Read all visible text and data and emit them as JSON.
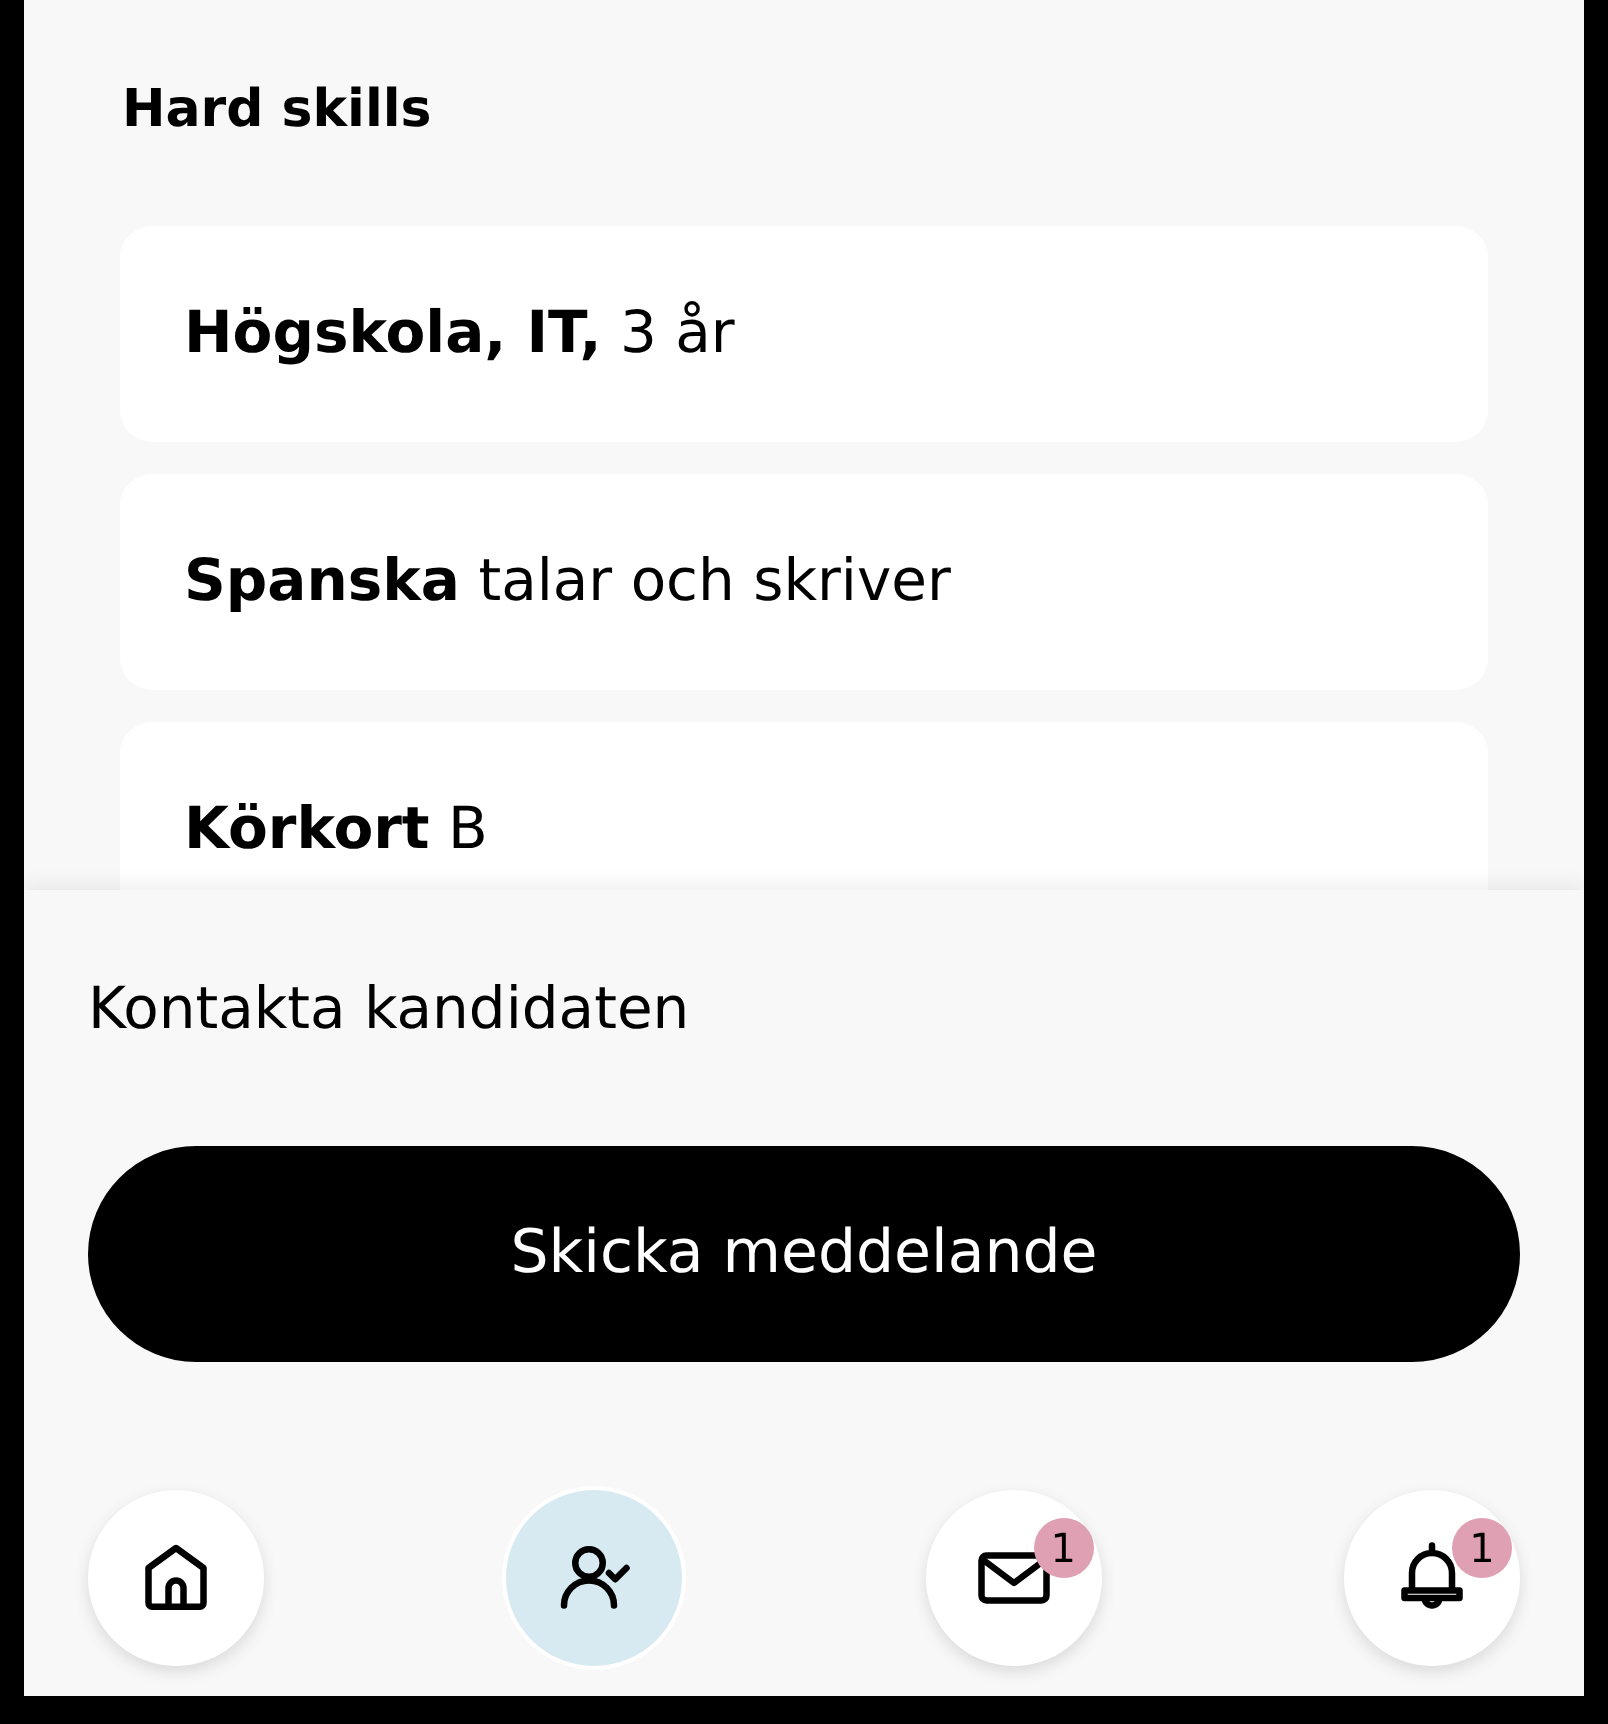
{
  "section": {
    "title": "Hard skills"
  },
  "skills": [
    {
      "text": "**Högskola, IT,** 3 år"
    },
    {
      "text": "**Spanska** talar och skriver"
    },
    {
      "text": "**Körkort** B"
    }
  ],
  "contact": {
    "label": "Kontakta kandidaten",
    "button": "Skicka meddelande"
  },
  "nav": [
    {
      "kind": "home",
      "selected": false
    },
    {
      "kind": "candidate",
      "selected": true
    },
    {
      "kind": "mail",
      "selected": false,
      "badge": "1"
    },
    {
      "kind": "bell",
      "selected": false,
      "badge": "1"
    }
  ]
}
